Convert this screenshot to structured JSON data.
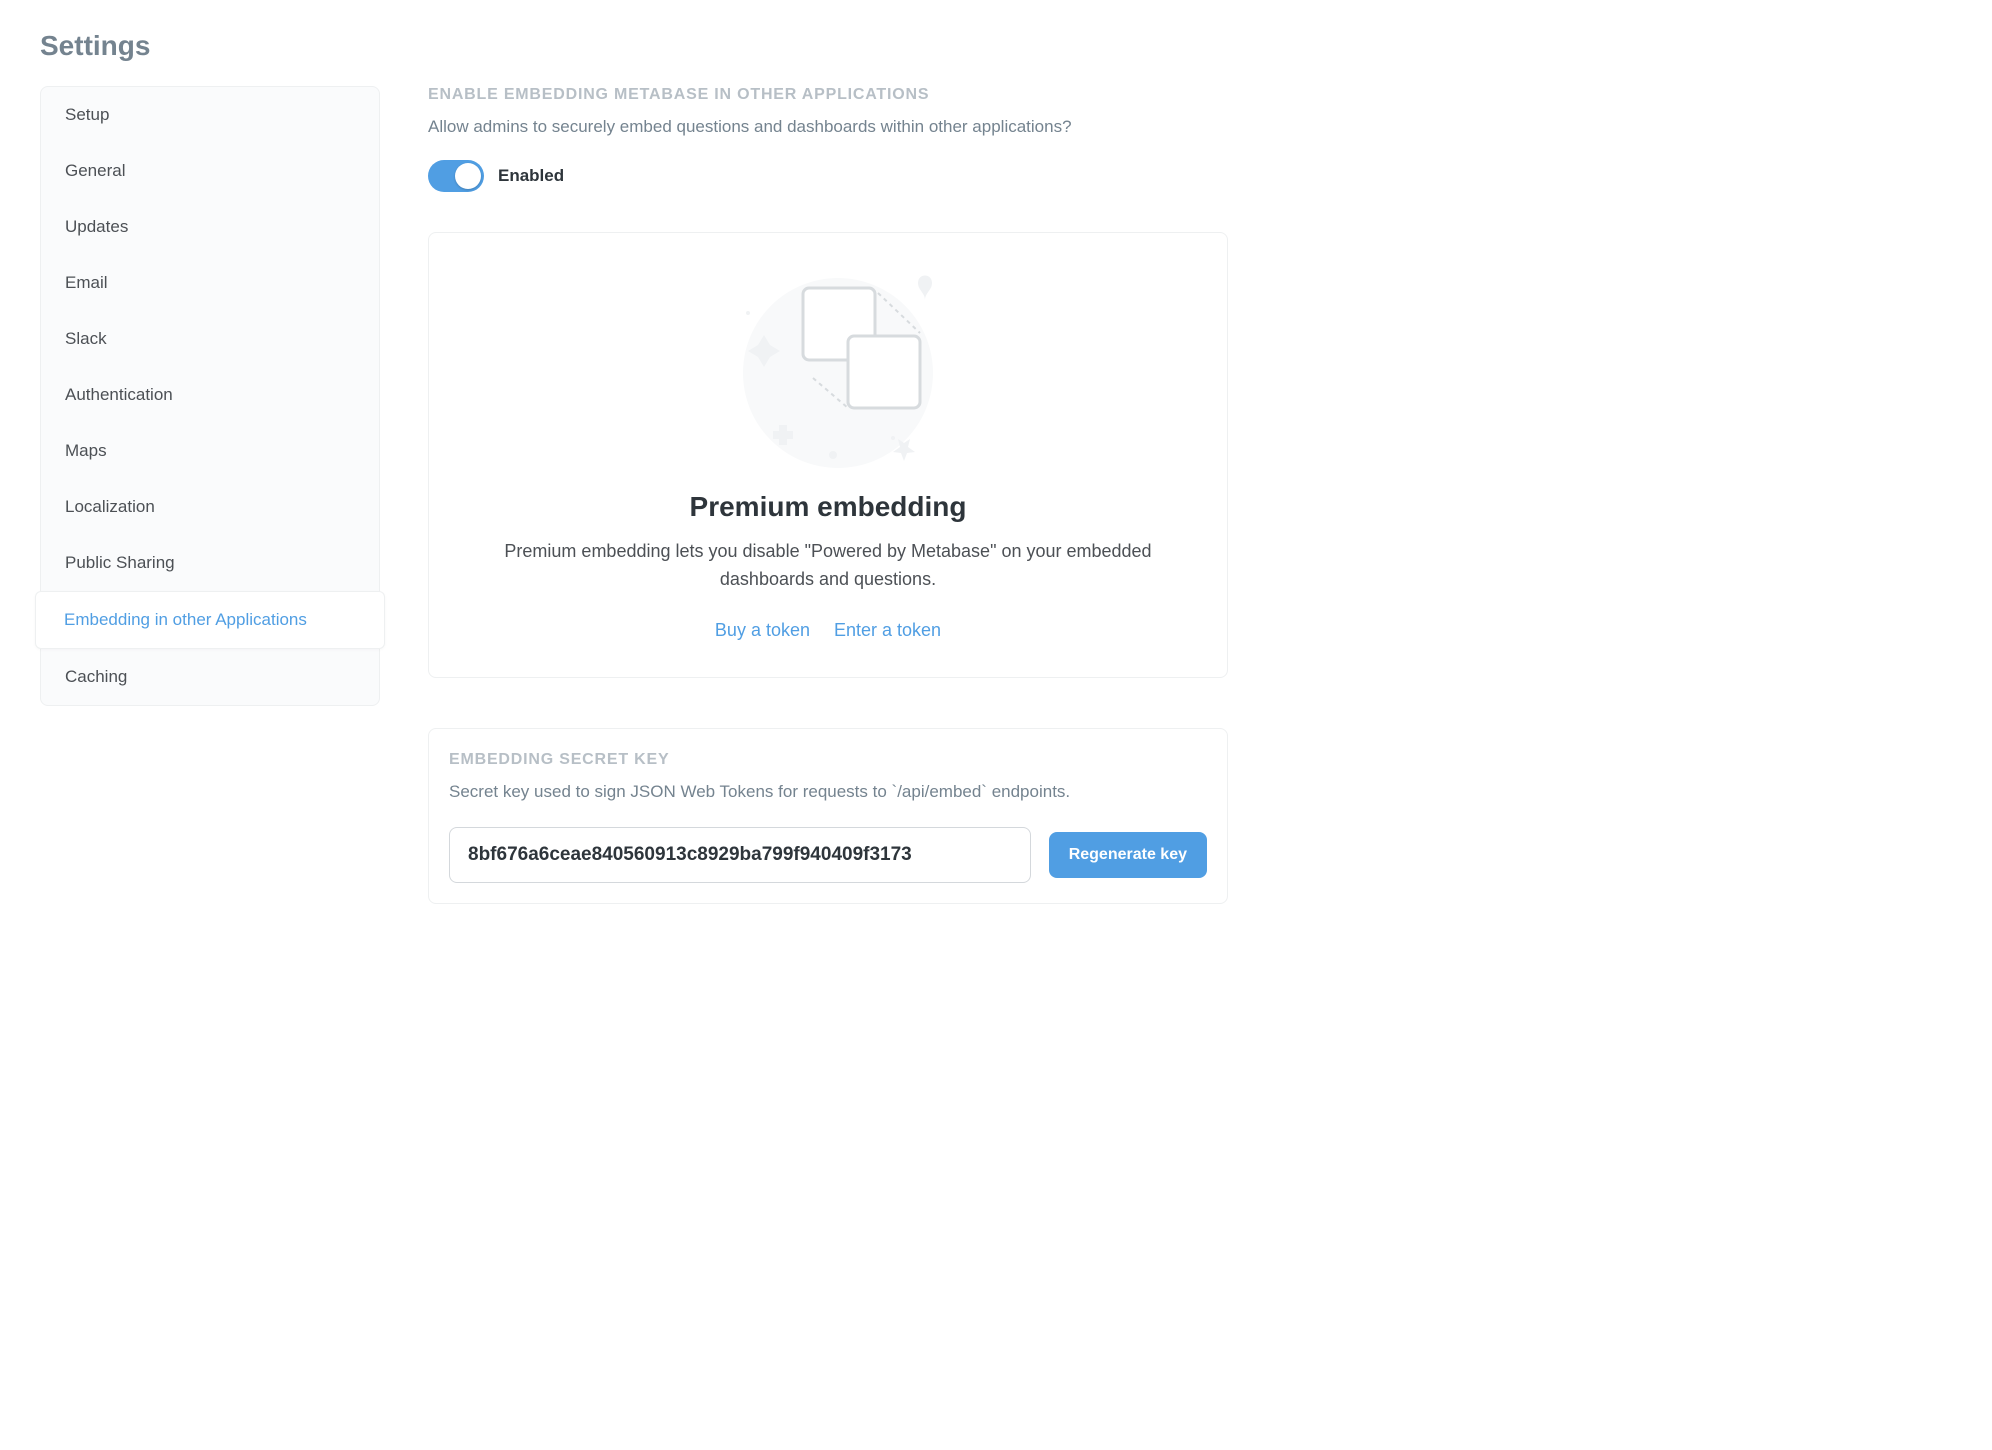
{
  "page": {
    "title": "Settings"
  },
  "sidebar": {
    "items": [
      {
        "label": "Setup",
        "slug": "setup",
        "active": false
      },
      {
        "label": "General",
        "slug": "general",
        "active": false
      },
      {
        "label": "Updates",
        "slug": "updates",
        "active": false
      },
      {
        "label": "Email",
        "slug": "email",
        "active": false
      },
      {
        "label": "Slack",
        "slug": "slack",
        "active": false
      },
      {
        "label": "Authentication",
        "slug": "authentication",
        "active": false
      },
      {
        "label": "Maps",
        "slug": "maps",
        "active": false
      },
      {
        "label": "Localization",
        "slug": "localization",
        "active": false
      },
      {
        "label": "Public Sharing",
        "slug": "public-sharing",
        "active": false
      },
      {
        "label": "Embedding in other Applications",
        "slug": "embedding",
        "active": true
      },
      {
        "label": "Caching",
        "slug": "caching",
        "active": false
      }
    ]
  },
  "embedding": {
    "enable_title": "ENABLE EMBEDDING METABASE IN OTHER APPLICATIONS",
    "enable_desc": "Allow admins to securely embed questions and dashboards within other applications?",
    "toggle_enabled": true,
    "toggle_label": "Enabled"
  },
  "premium": {
    "title": "Premium embedding",
    "desc": "Premium embedding lets you disable \"Powered by Metabase\" on your embedded dashboards and questions.",
    "buy_link": "Buy a token",
    "enter_link": "Enter a token"
  },
  "secret": {
    "title": "EMBEDDING SECRET KEY",
    "desc": "Secret key used to sign JSON Web Tokens for requests to `/api/embed` endpoints.",
    "key_value": "8bf676a6ceae840560913c8929ba799f940409f3173",
    "regenerate_label": "Regenerate key"
  }
}
